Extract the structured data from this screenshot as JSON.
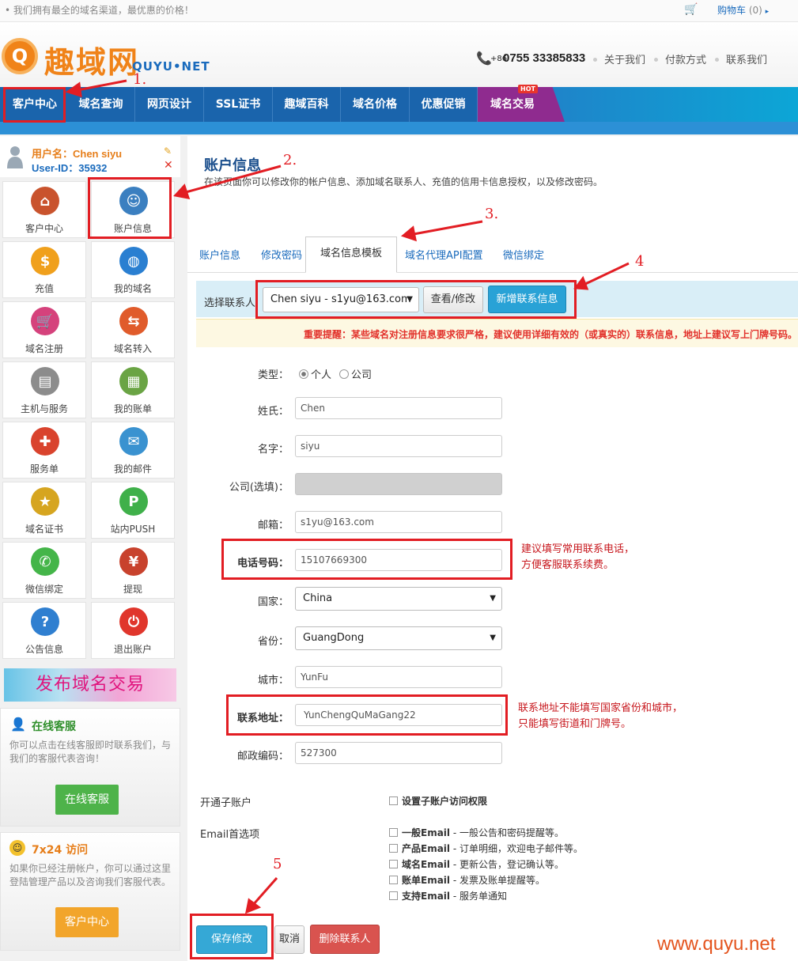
{
  "topbar": {
    "slogan": "我们拥有最全的域名渠道，最优惠的价格！",
    "cart_label": "购物车",
    "cart_count": "(0)"
  },
  "header": {
    "logo_text": "趣域网",
    "logo_sub": "QUYU•NET",
    "phone_prefix": "+86",
    "phone": "0755 33385833",
    "links": [
      "关于我们",
      "付款方式",
      "联系我们"
    ]
  },
  "nav": {
    "items": [
      "客户中心",
      "域名查询",
      "网页设计",
      "SSL证书",
      "趣域百科",
      "域名价格",
      "优惠促销",
      "域名交易"
    ],
    "hot_badge": "HOT"
  },
  "user": {
    "name": "用户名：Chen siyu",
    "id": "User-ID：35932"
  },
  "sidebar": {
    "tiles": [
      {
        "label": "客户中心",
        "icon": "home-icon"
      },
      {
        "label": "账户信息",
        "icon": "user-icon"
      },
      {
        "label": "充值",
        "icon": "coins-icon"
      },
      {
        "label": "我的域名",
        "icon": "globe-icon"
      },
      {
        "label": "域名注册",
        "icon": "cart-icon"
      },
      {
        "label": "域名转入",
        "icon": "transfer-icon"
      },
      {
        "label": "主机与服务",
        "icon": "server-icon"
      },
      {
        "label": "我的账单",
        "icon": "bill-icon"
      },
      {
        "label": "服务单",
        "icon": "lifebuoy-icon"
      },
      {
        "label": "我的邮件",
        "icon": "mail-icon"
      },
      {
        "label": "域名证书",
        "icon": "certificate-icon"
      },
      {
        "label": "站内PUSH",
        "icon": "push-icon"
      },
      {
        "label": "微信绑定",
        "icon": "wechat-icon"
      },
      {
        "label": "提现",
        "icon": "cash-icon"
      },
      {
        "label": "公告信息",
        "icon": "question-icon"
      },
      {
        "label": "退出账户",
        "icon": "power-icon"
      }
    ],
    "promo": "发布域名交易",
    "online": {
      "title": "在线客服",
      "desc": "你可以点击在线客服即时联系我们，与我们的客服代表咨询！",
      "button": "在线客服"
    },
    "visit": {
      "title": "7x24 访问",
      "desc": "如果你已经注册帐户，你可以通过这里登陆管理产品以及咨询我们客服代表。",
      "button": "客户中心"
    }
  },
  "main": {
    "title": "账户信息",
    "desc": "在该页面你可以修改你的帐户信息、添加域名联系人、充值的信用卡信息授权，以及修改密码。",
    "tabs": [
      "账户信息",
      "修改密码",
      "域名信息模板",
      "域名代理API配置",
      "微信绑定"
    ],
    "active_tab": "域名信息模板",
    "contact_label": "选择联系人",
    "contact_selected": "Chen siyu - s1yu@163.com",
    "view_button": "查看/修改",
    "add_button": "新增联系信息",
    "warning": "重要提醒：某些域名对注册信息要求很严格，建议使用详细有效的（或真实的）联系信息，地址上建议写上门牌号码。"
  },
  "form": {
    "type_label": "类型：",
    "type_person": "个人",
    "type_company": "公司",
    "surname_label": "姓氏：",
    "surname": "Chen",
    "name_label": "名字：",
    "name": "siyu",
    "company_label": "公司(选填)：",
    "company": "",
    "email_label": "邮箱：",
    "email": "s1yu@163.com",
    "phone_label": "电话号码：",
    "phone": "15107669300",
    "country_label": "国家：",
    "country": "China",
    "province_label": "省份：",
    "province": "GuangDong",
    "city_label": "城市：",
    "city": "YunFu",
    "address_label": "联系地址：",
    "address": "YunChengQuMaGang22",
    "zip_label": "邮政编码：",
    "zip": "527300",
    "subaccount_label": "开通子账户",
    "subaccount_option": "设置子账户访问权限",
    "email_pref_label": "Email首选项",
    "email_options": [
      {
        "bold": "一般Email",
        "rest": " - 一般公告和密码提醒等。"
      },
      {
        "bold": "产品Email",
        "rest": " - 订单明细，欢迎电子邮件等。"
      },
      {
        "bold": "域名Email",
        "rest": " - 更新公告，登记确认等。"
      },
      {
        "bold": "账单Email",
        "rest": " - 发票及账单提醒等。"
      },
      {
        "bold": "支持Email",
        "rest": " - 服务单通知"
      }
    ],
    "save_button": "保存修改",
    "cancel_button": "取消",
    "delete_button": "删除联系人"
  },
  "annotations": {
    "steps": [
      "1.",
      "2.",
      "3.",
      "4",
      "5"
    ],
    "phone_note_1": "建议填写常用联系电话，",
    "phone_note_2": "方便客服联系续费。",
    "address_note_1": "联系地址不能填写国家省份和城市，",
    "address_note_2": "只能填写街道和门牌号。",
    "watermark": "www.quyu.net"
  },
  "colors": {
    "nav": "#1a64ac",
    "accent": "#f08319",
    "annotation": "#e21d23",
    "button": "#29a2d6"
  }
}
